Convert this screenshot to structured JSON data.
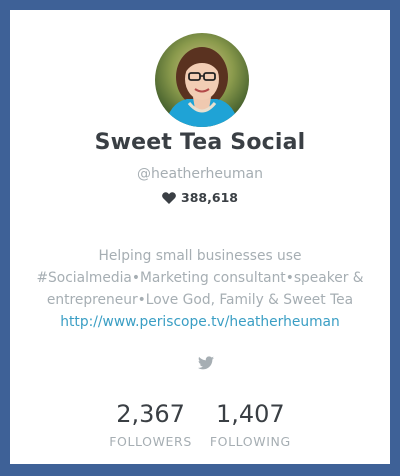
{
  "profile": {
    "display_name": "Sweet Tea Social",
    "handle": "@heatherheuman",
    "hearts": "388,618",
    "bio_line1": "Helping small businesses use",
    "bio_line2": "#Socialmedia•Marketing consultant•speaker &",
    "bio_line3": "entrepreneur•Love God, Family & Sweet Tea",
    "link": "http://www.periscope.tv/heatherheuman"
  },
  "stats": {
    "followers_count": "2,367",
    "followers_label": "FOLLOWERS",
    "following_count": "1,407",
    "following_label": "FOLLOWING"
  },
  "icons": {
    "heart": "heart-icon",
    "social": "twitter-icon"
  },
  "colors": {
    "background": "#3e6197",
    "card": "#ffffff",
    "name_text": "#3a3f44",
    "muted_text": "#a6aeb3",
    "link": "#3a9ec4"
  }
}
